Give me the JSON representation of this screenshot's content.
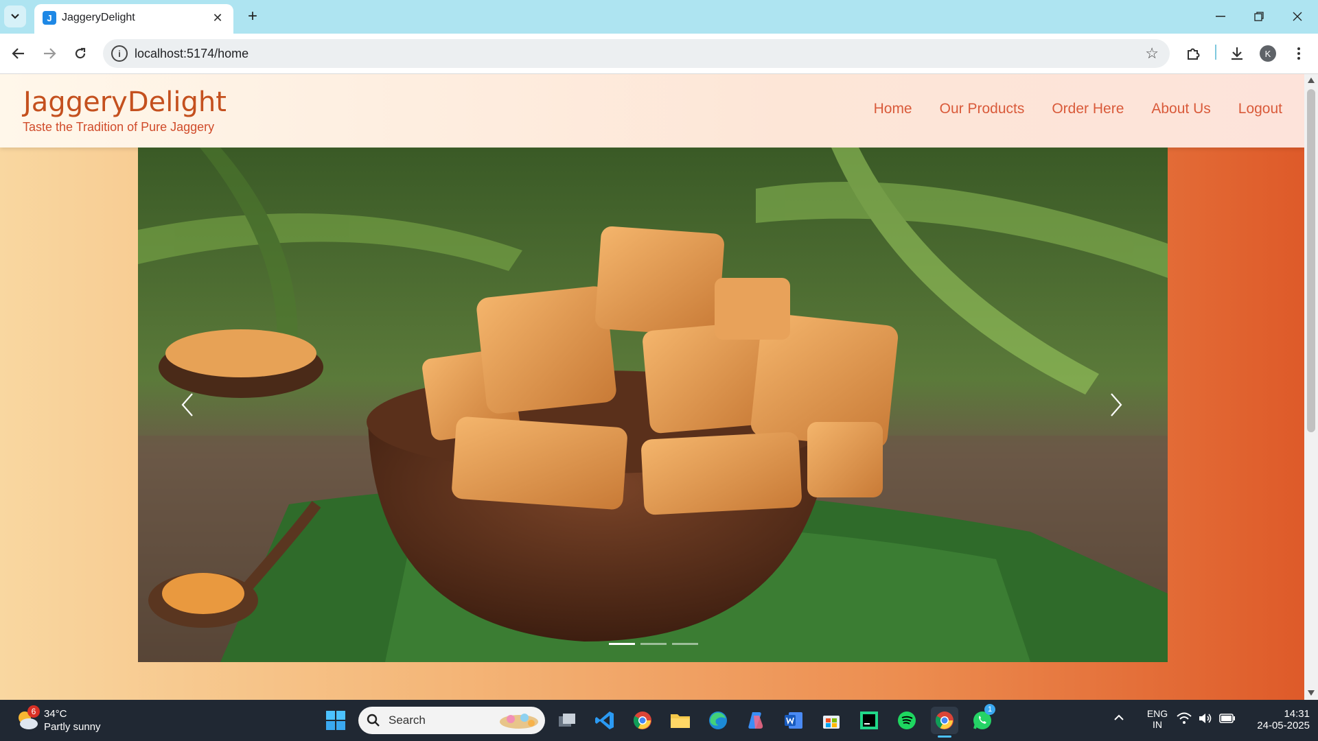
{
  "browser": {
    "tab_title": "JaggeryDelight",
    "tab_favicon_letter": "J",
    "url": "localhost:5174/home",
    "profile_initial": "K"
  },
  "site": {
    "brand": "JaggeryDelight",
    "tagline": "Taste the Tradition of Pure Jaggery",
    "nav": [
      "Home",
      "Our Products",
      "Order Here",
      "About Us",
      "Logout"
    ]
  },
  "carousel": {
    "slide_count": 3,
    "active_index": 0,
    "image_subject": "bowl of jaggery cubes on banana leaf"
  },
  "taskbar": {
    "weather_temp": "34°C",
    "weather_desc": "Partly sunny",
    "weather_badge": "6",
    "search_placeholder": "Search",
    "whatsapp_badge": "1",
    "lang_top": "ENG",
    "lang_bottom": "IN",
    "time": "14:31",
    "date": "24-05-2025"
  },
  "colors": {
    "brand": "#c4501e",
    "nav": "#d95a3a",
    "tabbar": "#aee4f1",
    "taskbar": "#202833"
  }
}
